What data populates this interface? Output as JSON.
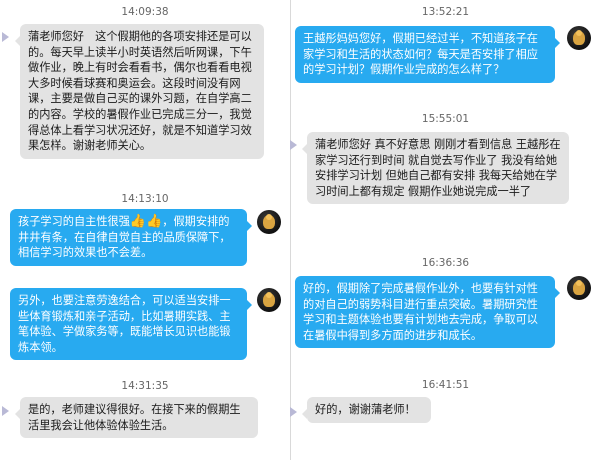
{
  "left": {
    "messages": [
      {
        "time": "14:09:38",
        "text": "蒲老师您好　这个假期他的各项安排还是可以的。每天早上读半小时英语然后听网课，下午做作业，晚上有时会看看书，偶尔也看看电视大多时候看球赛和奥运会。这段时间没有网课，主要是做自己买的课外习题，在自学高二的内容。学校的暑假作业已完成三分一，我觉得总体上看学习状况还好，就是不知道学习效果怎样。谢谢老师关心。"
      },
      {
        "time": "14:13:10",
        "text_before": "孩子学习的自主性很强",
        "emoji": "👍👍",
        "text_after": "，假期安排的井井有条，在自律自觉自主的品质保障下，相信学习的效果也不会差。"
      },
      {
        "text": "另外，也要注意劳逸结合，可以适当安排一些体育锻炼和亲子活动，比如暑期实践、主笔体验、学做家务等，既能增长见识也能锻炼本领。"
      },
      {
        "time": "14:31:35",
        "text": "是的，老师建议得很好。在接下来的假期生活里我会让他体验体验生活。"
      }
    ]
  },
  "right": {
    "messages": [
      {
        "time": "13:52:21",
        "text": "王越彤妈妈您好，假期已经过半，不知道孩子在家学习和生活的状态如何？每天是否安排了相应的学习计划？假期作业完成的怎么样了？"
      },
      {
        "time": "15:55:01",
        "text": "蒲老师您好 真不好意思 刚刚才看到信息 王越彤在家学习还行到时间 就自觉去写作业了 我没有给她安排学习计划 但她自己都有安排 我每天给她在学习时间上都有规定 假期作业她说完成一半了"
      },
      {
        "time": "16:36:36",
        "text": "好的，假期除了完成暑假作业外，也要有针对性的对自己的弱势科目进行重点突破。暑期研究性学习和主题体验也要有计划地去完成，争取可以在暑假中得到多方面的进步和成长。"
      },
      {
        "time": "16:41:51",
        "text": "好的，谢谢蒲老师！"
      }
    ]
  }
}
